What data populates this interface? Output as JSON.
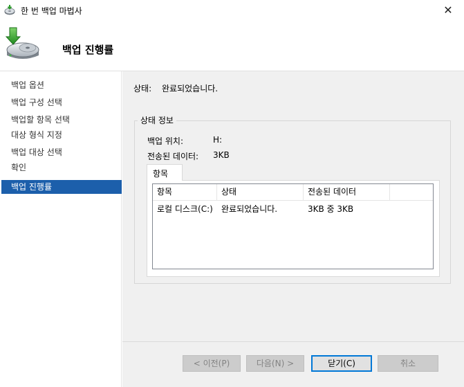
{
  "window": {
    "title": "한 번 백업 마법사",
    "close_glyph": "✕"
  },
  "header": {
    "title": "백업 진행률"
  },
  "sidebar": {
    "items": [
      {
        "label": "백업 옵션"
      },
      {
        "label": "백업 구성 선택"
      },
      {
        "label": "백업할 항목 선택"
      },
      {
        "label": "대상 형식 지정"
      },
      {
        "label": "백업 대상 선택"
      },
      {
        "label": "확인"
      },
      {
        "label": "백업 진행률"
      }
    ],
    "active_index": 6
  },
  "main": {
    "status_label": "상태:",
    "status_value": "완료되었습니다.",
    "group_title": "상태 정보",
    "location_label": "백업 위치:",
    "location_value": "H:",
    "transferred_label": "전송된 데이터:",
    "transferred_value": "3KB",
    "tab_label": "항목",
    "table": {
      "columns": [
        "항목",
        "상태",
        "전송된 데이터"
      ],
      "rows": [
        [
          "로컬 디스크(C:)",
          "완료되었습니다.",
          "3KB 중 3KB"
        ]
      ]
    }
  },
  "footer": {
    "prev_label": "< 이전(P)",
    "next_label": "다음(N) >",
    "close_label": "닫기(C)",
    "cancel_label": "취소"
  },
  "colors": {
    "accent": "#0078d7",
    "selection": "#1c5fab",
    "panel": "#f0f0f0"
  }
}
